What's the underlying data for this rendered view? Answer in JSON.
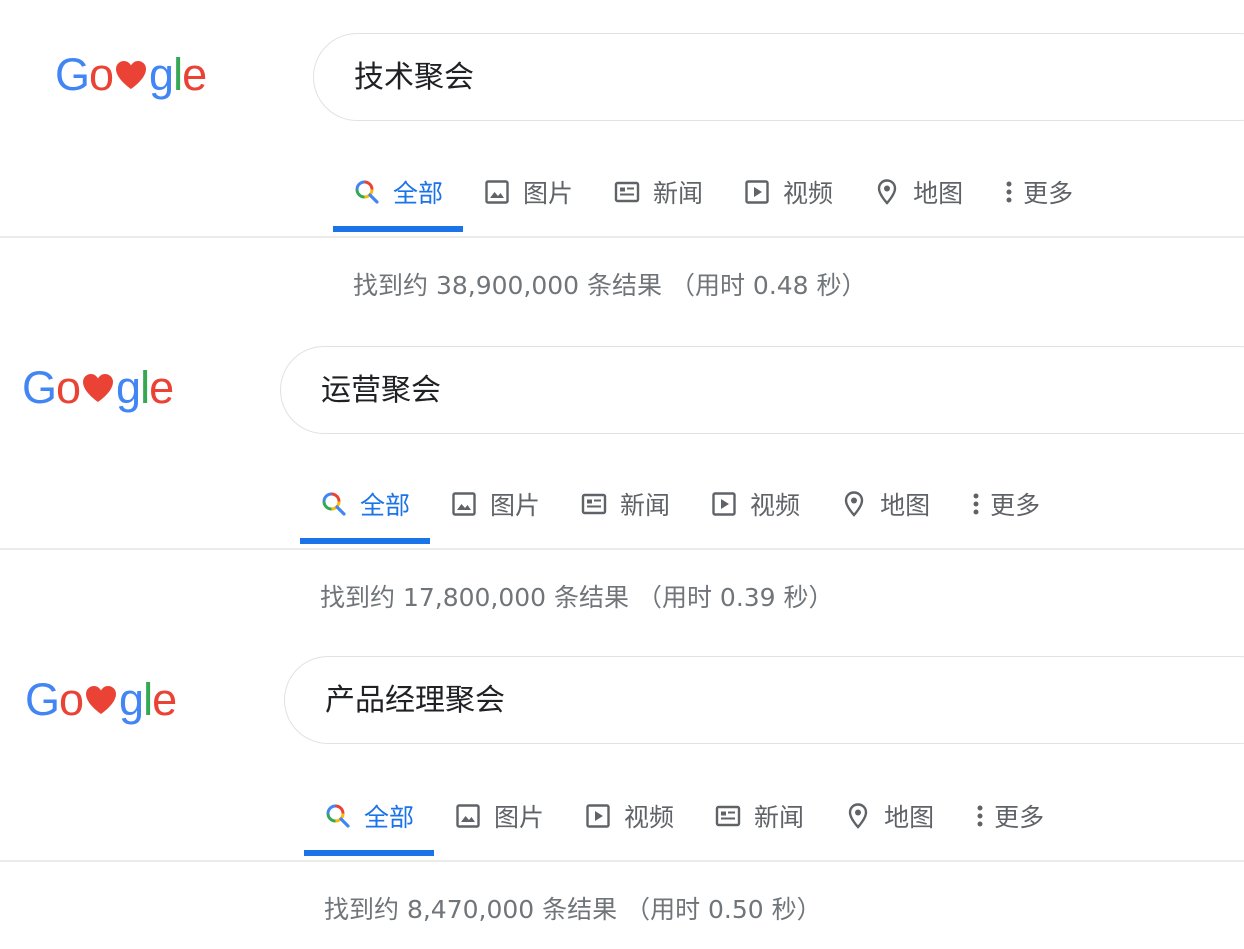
{
  "brand_colors": {
    "blue": "#4285f4",
    "red": "#ea4335",
    "yellow": "#fbbc05",
    "green": "#34a853",
    "active_tab": "#1a73e8"
  },
  "logo": {
    "letter_1": "G",
    "letter_2": "o",
    "heart_icon": "heart-icon",
    "letter_4": "g",
    "letter_5": "l",
    "letter_6": "e"
  },
  "panels": [
    {
      "query": "技术聚会",
      "tabs": [
        {
          "label": "全部",
          "icon": "search-icon",
          "active": true
        },
        {
          "label": "图片",
          "icon": "image-icon"
        },
        {
          "label": "新闻",
          "icon": "news-icon"
        },
        {
          "label": "视频",
          "icon": "video-icon"
        },
        {
          "label": "地图",
          "icon": "map-pin-icon"
        },
        {
          "label": "更多",
          "icon": "more-vertical-icon"
        }
      ],
      "result_stats": "找到约 38,900,000 条结果 （用时 0.48 秒）"
    },
    {
      "query": "运营聚会",
      "tabs": [
        {
          "label": "全部",
          "icon": "search-icon",
          "active": true
        },
        {
          "label": "图片",
          "icon": "image-icon"
        },
        {
          "label": "新闻",
          "icon": "news-icon"
        },
        {
          "label": "视频",
          "icon": "video-icon"
        },
        {
          "label": "地图",
          "icon": "map-pin-icon"
        },
        {
          "label": "更多",
          "icon": "more-vertical-icon"
        }
      ],
      "result_stats": "找到约 17,800,000 条结果 （用时 0.39 秒）"
    },
    {
      "query": "产品经理聚会",
      "tabs": [
        {
          "label": "全部",
          "icon": "search-icon",
          "active": true
        },
        {
          "label": "图片",
          "icon": "image-icon"
        },
        {
          "label": "视频",
          "icon": "video-icon"
        },
        {
          "label": "新闻",
          "icon": "news-icon"
        },
        {
          "label": "地图",
          "icon": "map-pin-icon"
        },
        {
          "label": "更多",
          "icon": "more-vertical-icon"
        }
      ],
      "result_stats": "找到约 8,470,000 条结果 （用时 0.50 秒）"
    }
  ]
}
